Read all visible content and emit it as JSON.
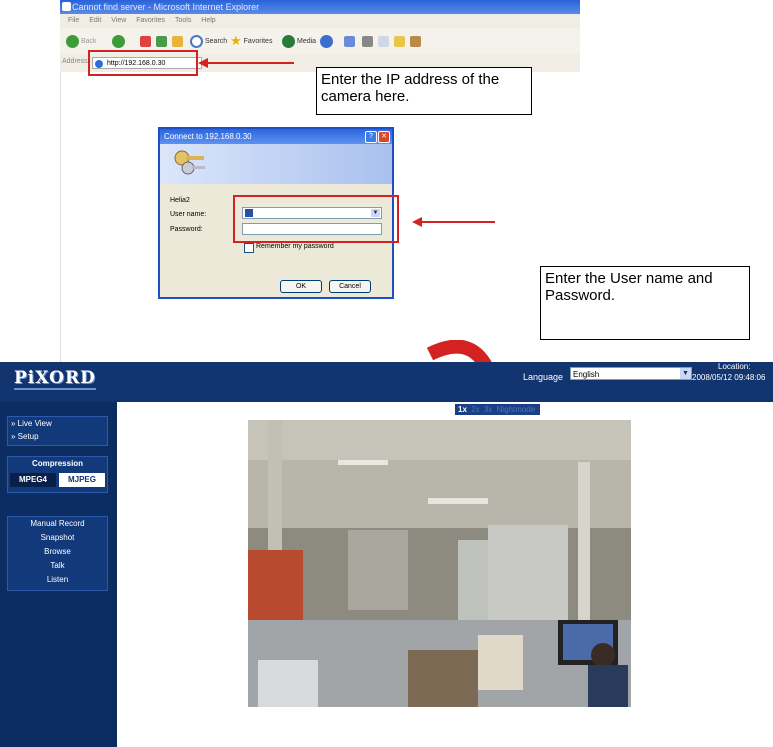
{
  "browser": {
    "title": "Cannot find server - Microsoft Internet Explorer",
    "menu": [
      "File",
      "Edit",
      "View",
      "Favorites",
      "Tools",
      "Help"
    ],
    "toolbar": {
      "back": "Back",
      "search": "Search",
      "favorites": "Favorites",
      "media": "Media"
    },
    "address_label": "Address",
    "address_value": "http://192.168.0.30"
  },
  "callouts": {
    "ip": "Enter the IP address of the camera here.",
    "credentials": "Enter the User name and Password."
  },
  "login_dialog": {
    "title": "Connect to 192.168.0.30",
    "realm": "Helia2",
    "username_label": "User name:",
    "password_label": "Password:",
    "remember_label": "Remember my password",
    "ok_label": "OK",
    "cancel_label": "Cancel"
  },
  "app": {
    "logo": "PiXORD",
    "language_label": "Language",
    "language_value": "English",
    "location_label": "Location:",
    "location_time": "2008/05/12 09:48:06",
    "nav": [
      "» Live View",
      "» Setup"
    ],
    "compression": {
      "title": "Compression",
      "options": [
        "MPEG4",
        "MJPEG"
      ],
      "selected": "MPEG4"
    },
    "actions": [
      "Manual Record",
      "Snapshot",
      "Browse",
      "Talk",
      "Listen"
    ],
    "zoom_links": [
      "1x",
      "2x",
      "3x",
      "Nightmode"
    ]
  },
  "colors": {
    "highlight_red": "#d42121",
    "app_header": "#123570",
    "sidebar": "#0c2d62"
  }
}
